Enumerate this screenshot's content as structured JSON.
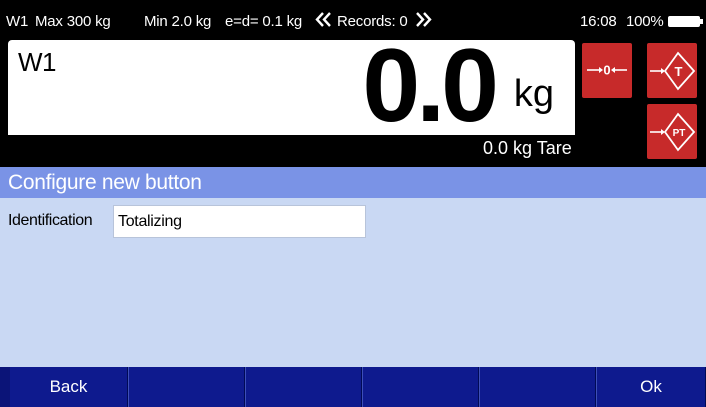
{
  "status": {
    "scale": "W1",
    "max": "Max 300 kg",
    "min": "Min 2.0 kg",
    "division": "e=d= 0.1 kg",
    "records_prev_icon": "double-chevron-left-icon",
    "records": "Records: 0",
    "records_next_icon": "double-chevron-right-icon",
    "time": "16:08",
    "battery": "100%"
  },
  "display": {
    "scale_name": "W1",
    "weight": "0.0",
    "unit": "kg",
    "tare": "0.0 kg Tare"
  },
  "function_keys": [
    {
      "name": "zero",
      "icon": "zero-key-icon",
      "label": "0"
    },
    {
      "name": "tare",
      "icon": "tare-key-icon",
      "label": "T"
    },
    {
      "name": "preset-tare",
      "icon": "preset-tare-key-icon",
      "label": "PT"
    }
  ],
  "config": {
    "title": "Configure new button",
    "identification_label": "Identification",
    "identification_value": "Totalizing"
  },
  "softkeys": [
    "Back",
    "",
    "",
    "",
    "",
    "Ok"
  ],
  "colors": {
    "header_bar": "#7a93e6",
    "config_bg": "#c9d8f3",
    "softkey_bg": "#0e1a8e",
    "function_key": "#c72a2a"
  }
}
